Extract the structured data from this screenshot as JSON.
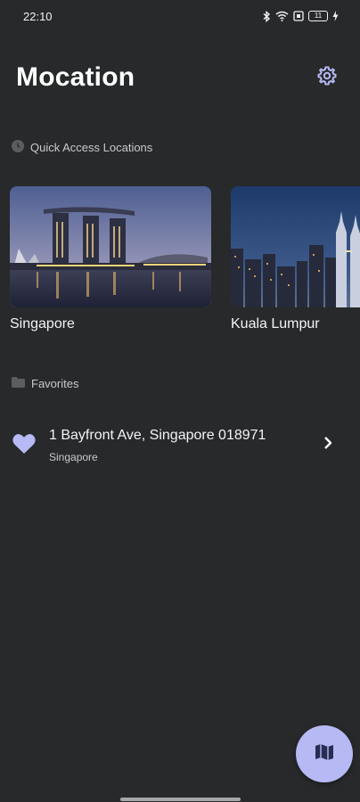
{
  "status_bar": {
    "time": "22:10",
    "battery": "11",
    "icons": [
      "bluetooth-icon",
      "wifi-icon",
      "screen-record-icon",
      "battery-icon",
      "charging-icon"
    ]
  },
  "header": {
    "title": "Mocation",
    "settings_icon": "gear-icon"
  },
  "quick_access": {
    "label": "Quick Access Locations",
    "icon": "clock-icon",
    "locations": [
      {
        "name": "Singapore",
        "image": "singapore-skyline-night"
      },
      {
        "name": "Kuala Lumpur",
        "image": "kuala-lumpur-skyline-night"
      }
    ]
  },
  "favorites": {
    "label": "Favorites",
    "icon": "folder-icon",
    "items": [
      {
        "address": "1 Bayfront Ave, Singapore 018971",
        "city": "Singapore",
        "icon": "heart-icon"
      }
    ]
  },
  "fab": {
    "icon": "map-icon"
  },
  "colors": {
    "background": "#27292a",
    "accent": "#b6b9f4",
    "text_primary": "#f4f4f5",
    "text_secondary": "#c9cacc"
  }
}
